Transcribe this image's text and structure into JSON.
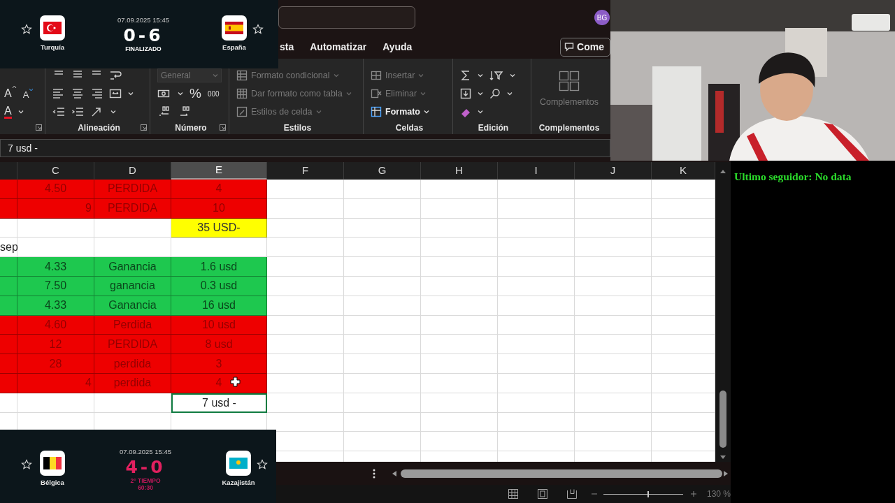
{
  "scoreboards": [
    {
      "date": "07.09.2025 15:45",
      "home": {
        "name": "Turquía"
      },
      "away": {
        "name": "España"
      },
      "score": "0-6",
      "status": [
        "FINALIZADO"
      ],
      "live": false
    },
    {
      "date": "07.09.2025 15:45",
      "home": {
        "name": "Bélgica"
      },
      "away": {
        "name": "Kazajistán"
      },
      "score": "4-0",
      "status": [
        "2° TIEMPO",
        "60:30"
      ],
      "live": true
    }
  ],
  "excel": {
    "avatar": "BG",
    "tabs": [
      {
        "label": "sta",
        "selected": false
      },
      {
        "label": "Automatizar",
        "selected": false
      },
      {
        "label": "Ayuda",
        "selected": false
      }
    ],
    "comments_button": "Come",
    "ribbon": {
      "font_buttons": [
        "A",
        "A",
        "A"
      ],
      "number_symbols": [
        "%",
        "000"
      ],
      "groups": [
        {
          "label": "Alineación"
        },
        {
          "label": "Número",
          "items": [
            {
              "label": "General",
              "disabled": true
            }
          ]
        },
        {
          "label": "Estilos",
          "items": [
            {
              "label": "Formato condicional",
              "disabled": true
            },
            {
              "label": "Dar formato como tabla",
              "disabled": true
            },
            {
              "label": "Estilos de celda",
              "disabled": true
            }
          ]
        },
        {
          "label": "Celdas",
          "items": [
            {
              "label": "Insertar",
              "disabled": true
            },
            {
              "label": "Eliminar",
              "disabled": true
            },
            {
              "label": "Formato",
              "disabled": false
            }
          ]
        },
        {
          "label": "Edición"
        },
        {
          "label": "Complementos",
          "items": [
            {
              "label": "Complementos",
              "disabled": true
            }
          ]
        }
      ]
    },
    "formula": "7 usd -",
    "columns": [
      {
        "selected": false
      },
      {
        "letter": "C",
        "selected": false
      },
      {
        "letter": "D",
        "selected": false
      },
      {
        "letter": "E",
        "selected": true
      },
      {
        "letter": "F",
        "selected": false
      },
      {
        "letter": "G",
        "selected": false
      },
      {
        "letter": "H",
        "selected": false
      },
      {
        "letter": "I",
        "selected": false
      },
      {
        "letter": "J",
        "selected": false
      },
      {
        "letter": "K",
        "selected": false
      }
    ],
    "rows": [
      {
        "color": "#ee0000",
        "cells": [
          {
            "selected": false
          },
          {
            "text": "4.50",
            "selected": false
          },
          {
            "text": "PERDIDA",
            "selected": false
          },
          {
            "text": "4",
            "selected": false
          }
        ]
      },
      {
        "color": "#ee0000",
        "cells": [
          {
            "selected": false
          },
          {
            "text": "9",
            "kind": "number",
            "selected": false
          },
          {
            "text": "PERDIDA",
            "selected": false
          },
          {
            "text": "10",
            "selected": false
          }
        ]
      },
      {
        "cells": [
          {
            "selected": false
          },
          {
            "selected": false
          },
          {
            "selected": false
          },
          {
            "text": "35 USD-",
            "color": "#ffff00",
            "selected": false
          }
        ]
      },
      {
        "cells": [
          {
            "text": "sep",
            "kind": "label",
            "selected": false
          },
          {
            "selected": false
          },
          {
            "selected": false
          },
          {
            "selected": false
          }
        ]
      },
      {
        "color": "#1ec84f",
        "cells": [
          {
            "selected": false
          },
          {
            "text": "4.33",
            "selected": false
          },
          {
            "text": "Ganancia",
            "selected": false
          },
          {
            "text": "1.6 usd",
            "selected": false
          }
        ]
      },
      {
        "color": "#1ec84f",
        "cells": [
          {
            "selected": false
          },
          {
            "text": "7.50",
            "selected": false
          },
          {
            "text": "ganancia",
            "selected": false
          },
          {
            "text": "0.3 usd",
            "selected": false
          }
        ]
      },
      {
        "color": "#1ec84f",
        "cells": [
          {
            "selected": false
          },
          {
            "text": "4.33",
            "selected": false
          },
          {
            "text": "Ganancia",
            "selected": false
          },
          {
            "text": "16 usd",
            "selected": false
          }
        ]
      },
      {
        "color": "#ee0000",
        "cells": [
          {
            "selected": false
          },
          {
            "text": "4.60",
            "selected": false
          },
          {
            "text": "Perdida",
            "selected": false
          },
          {
            "text": "10 usd",
            "selected": false
          }
        ]
      },
      {
        "color": "#ee0000",
        "cells": [
          {
            "selected": false
          },
          {
            "text": "12",
            "selected": false
          },
          {
            "text": "PERDIDA",
            "selected": false
          },
          {
            "text": "8 usd",
            "selected": false
          }
        ]
      },
      {
        "color": "#ee0000",
        "cells": [
          {
            "selected": false
          },
          {
            "text": "28",
            "selected": false
          },
          {
            "text": "perdida",
            "selected": false
          },
          {
            "text": "3",
            "selected": false
          }
        ]
      },
      {
        "color": "#ee0000",
        "cells": [
          {
            "selected": false
          },
          {
            "text": "4",
            "kind": "number",
            "selected": false
          },
          {
            "text": "perdida",
            "selected": false
          },
          {
            "text": "4",
            "selected": false
          }
        ]
      },
      {
        "cells": [
          {
            "selected": false
          },
          {
            "selected": false
          },
          {
            "selected": false
          },
          {
            "text": "7 usd -",
            "selected": true
          }
        ]
      }
    ],
    "status_bar": {
      "zoom_slider": {
        "level": 0.55
      },
      "zoom": "130 %"
    }
  },
  "overlay_text": "Ultimo seguidor: No data"
}
